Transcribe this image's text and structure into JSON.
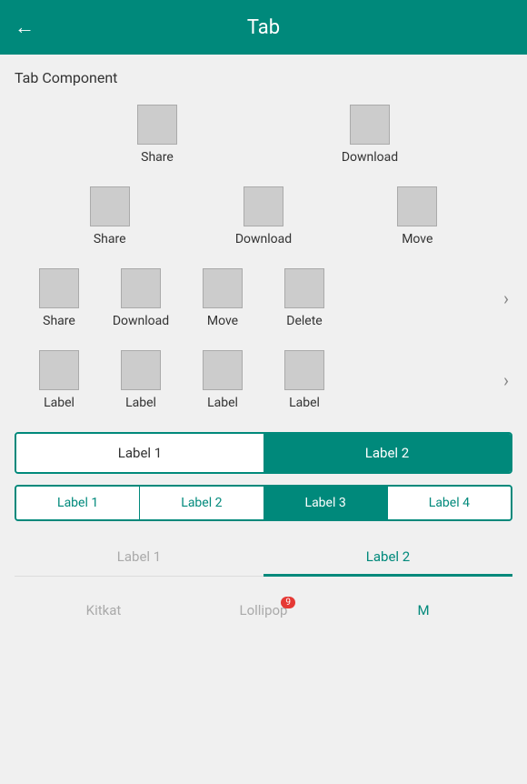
{
  "header": {
    "title": "Tab",
    "back_label": "←"
  },
  "section_title": "Tab Component",
  "row1": {
    "items": [
      {
        "label": "Share"
      },
      {
        "label": "Download"
      }
    ]
  },
  "row2": {
    "items": [
      {
        "label": "Share"
      },
      {
        "label": "Download"
      },
      {
        "label": "Move"
      }
    ]
  },
  "row3": {
    "items": [
      {
        "label": "Share"
      },
      {
        "label": "Download"
      },
      {
        "label": "Move"
      },
      {
        "label": "Delete"
      }
    ],
    "chevron": "›"
  },
  "row4": {
    "items": [
      {
        "label": "Label"
      },
      {
        "label": "Label"
      },
      {
        "label": "Label"
      },
      {
        "label": "Label"
      }
    ],
    "chevron": "›"
  },
  "tabs": {
    "tab2": {
      "items": [
        {
          "label": "Label 1",
          "state": "inactive"
        },
        {
          "label": "Label 2",
          "state": "active"
        }
      ]
    },
    "tab4": {
      "items": [
        {
          "label": "Label 1",
          "state": "inactive"
        },
        {
          "label": "Label 2",
          "state": "inactive"
        },
        {
          "label": "Label 3",
          "state": "active"
        },
        {
          "label": "Label 4",
          "state": "inactive"
        }
      ]
    },
    "tab_underline": {
      "items": [
        {
          "label": "Label 1",
          "state": "inactive"
        },
        {
          "label": "Label 2",
          "state": "active"
        }
      ]
    },
    "tab_bottom": {
      "items": [
        {
          "label": "Kitkat",
          "state": "inactive",
          "badge": null
        },
        {
          "label": "Lollipop",
          "state": "inactive",
          "badge": "9"
        },
        {
          "label": "M",
          "state": "active",
          "badge": null
        }
      ]
    }
  }
}
